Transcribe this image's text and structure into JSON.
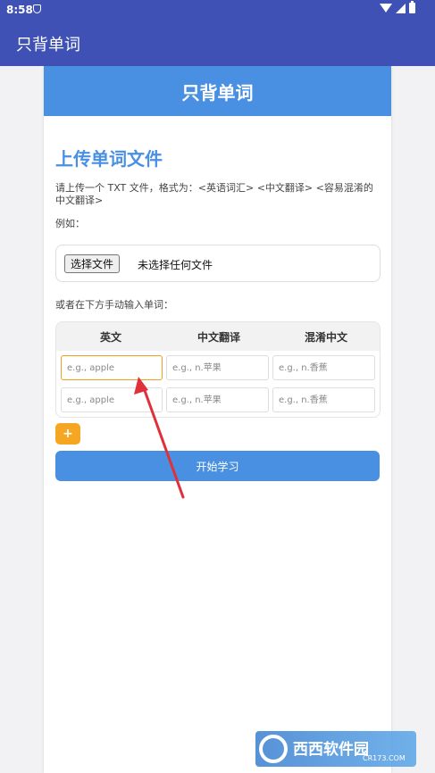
{
  "status_bar": {
    "time": "8:58",
    "icons": [
      "shield-icon",
      "wifi-icon",
      "signal-icon",
      "battery-icon"
    ]
  },
  "app_bar": {
    "title": "只背单词"
  },
  "card": {
    "header": "只背单词",
    "upload_title": "上传单词文件",
    "instructions": "请上传一个 TXT 文件，格式为：<英语词汇> <中文翻译> <容易混淆的中文翻译>",
    "example_label": "例如：",
    "file_picker": {
      "button_label": "选择文件",
      "status": "未选择任何文件"
    },
    "manual_label": "或者在下方手动输入单词：",
    "table": {
      "headers": [
        "英文",
        "中文翻译",
        "混淆中文"
      ],
      "rows": [
        {
          "english": {
            "value": "",
            "placeholder": "e.g., apple"
          },
          "chinese": {
            "value": "",
            "placeholder": "e.g., n.苹果"
          },
          "confusing": {
            "value": "",
            "placeholder": "e.g., n.香蕉"
          }
        },
        {
          "english": {
            "value": "",
            "placeholder": "e.g., apple"
          },
          "chinese": {
            "value": "",
            "placeholder": "e.g., n.苹果"
          },
          "confusing": {
            "value": "",
            "placeholder": "e.g., n.香蕉"
          }
        }
      ]
    },
    "add_button_label": "+",
    "start_button_label": "开始学习"
  },
  "watermark": {
    "text": "西西软件园",
    "sub": "CR173.COM"
  },
  "colors": {
    "app_bar": "#3f51b5",
    "card_header": "#4a90e2",
    "title_text": "#4a90e2",
    "add_button": "#f5a623",
    "start_button": "#4a90e2",
    "focus_border": "#f0a020",
    "annotation_arrow": "#e0303a"
  }
}
